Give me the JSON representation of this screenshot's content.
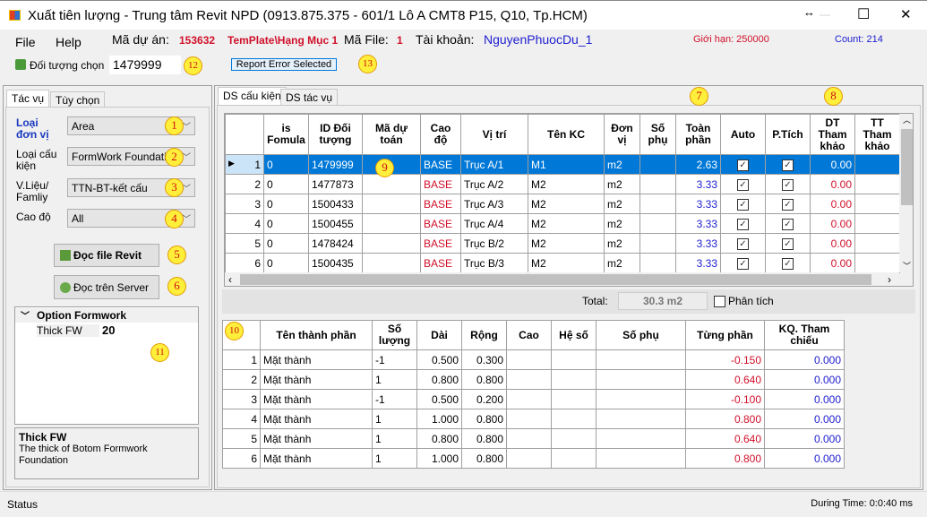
{
  "window": {
    "title": "Xuất tiên lượng - Trung tâm Revit NPD (0913.875.375 - 601/1 Lô A CMT8 P15, Q10, Tp.HCM)",
    "resize_icon": "↔",
    "minimize": "—",
    "maximize": "☐",
    "close": "✕"
  },
  "menu": {
    "file": "File",
    "help": "Help",
    "project_label": "Mã dự án:",
    "project_code": "153632",
    "template": "TemPlate\\Hạng Mục 1",
    "file_label": "Mã File:",
    "file_code": "1",
    "account_label": "Tài khoản:",
    "account": "NguyenPhuocDu_1",
    "limit": "Giới hạn: 250000",
    "count": "Count: 214"
  },
  "toolbar": {
    "selected_label": "Đối tượng chọn",
    "selected_value": "1479999",
    "report_button": "Report Error Selected"
  },
  "left": {
    "tabs": [
      "Tác vụ",
      "Tùy chọn"
    ],
    "fields": [
      {
        "label": "Loại đơn vị",
        "value": "Area"
      },
      {
        "label": "Loại cấu kiện",
        "value": "FormWork Foundation"
      },
      {
        "label": "V.Liệu/ Famliy",
        "value": "TTN-BT-kết cấu"
      },
      {
        "label": "Cao độ",
        "value": "All"
      }
    ],
    "read_revit": "Đọc file Revit",
    "read_server": "Đọc trên Server",
    "property_grid": {
      "category": "Option Formwork",
      "prop_name": "Thick FW",
      "prop_value": "20",
      "desc_title": "Thick FW",
      "desc_text": "The thick of Botom Formwork Foundation"
    }
  },
  "right": {
    "tabs": [
      "DS cấu kiện",
      "DS tác vụ"
    ],
    "grid": {
      "columns": [
        "is Fomula",
        "ID Đối tượng",
        "Mã dự toán",
        "Cao độ",
        "Vị trí",
        "Tên KC",
        "Đơn vị",
        "Số phụ",
        "Toàn phần",
        "Auto",
        "P.Tích",
        "DT Tham khảo",
        "TT Tham khảo"
      ],
      "rows": [
        {
          "n": "1",
          "f": "0",
          "id": "1479999",
          "ma": "",
          "cao": "BASE",
          "vt": "Trục A/1",
          "kc": "M1",
          "dv": "m2",
          "sp": "",
          "tp": "2.63",
          "auto": true,
          "pt": true,
          "dt": "0.00",
          "tt": ""
        },
        {
          "n": "2",
          "f": "0",
          "id": "1477873",
          "ma": "",
          "cao": "BASE",
          "vt": "Trục A/2",
          "kc": "M2",
          "dv": "m2",
          "sp": "",
          "tp": "3.33",
          "auto": true,
          "pt": true,
          "dt": "0.00",
          "tt": ""
        },
        {
          "n": "3",
          "f": "0",
          "id": "1500433",
          "ma": "",
          "cao": "BASE",
          "vt": "Trục A/3",
          "kc": "M2",
          "dv": "m2",
          "sp": "",
          "tp": "3.33",
          "auto": true,
          "pt": true,
          "dt": "0.00",
          "tt": ""
        },
        {
          "n": "4",
          "f": "0",
          "id": "1500455",
          "ma": "",
          "cao": "BASE",
          "vt": "Trục A/4",
          "kc": "M2",
          "dv": "m2",
          "sp": "",
          "tp": "3.33",
          "auto": true,
          "pt": true,
          "dt": "0.00",
          "tt": ""
        },
        {
          "n": "5",
          "f": "0",
          "id": "1478424",
          "ma": "",
          "cao": "BASE",
          "vt": "Trục B/2",
          "kc": "M2",
          "dv": "m2",
          "sp": "",
          "tp": "3.33",
          "auto": true,
          "pt": true,
          "dt": "0.00",
          "tt": ""
        },
        {
          "n": "6",
          "f": "0",
          "id": "1500435",
          "ma": "",
          "cao": "BASE",
          "vt": "Trục B/3",
          "kc": "M2",
          "dv": "m2",
          "sp": "",
          "tp": "3.33",
          "auto": true,
          "pt": true,
          "dt": "0.00",
          "tt": ""
        }
      ]
    },
    "total_label": "Total:",
    "total_value": "30.3 m2",
    "analyze_label": "Phân tích",
    "detail": {
      "columns": [
        "Tên thành phần",
        "Số lượng",
        "Dài",
        "Rộng",
        "Cao",
        "Hệ số",
        "Số phụ",
        "Từng phần",
        "KQ. Tham chiếu"
      ],
      "rows": [
        [
          "1",
          "Mặt thành",
          "-1",
          "0.500",
          "0.300",
          "",
          "",
          "",
          "-0.150",
          "0.000"
        ],
        [
          "2",
          "Mặt thành",
          "1",
          "0.800",
          "0.800",
          "",
          "",
          "",
          "0.640",
          "0.000"
        ],
        [
          "3",
          "Mặt thành",
          "-1",
          "0.500",
          "0.200",
          "",
          "",
          "",
          "-0.100",
          "0.000"
        ],
        [
          "4",
          "Mặt thành",
          "1",
          "1.000",
          "0.800",
          "",
          "",
          "",
          "0.800",
          "0.000"
        ],
        [
          "5",
          "Mặt thành",
          "1",
          "0.800",
          "0.800",
          "",
          "",
          "",
          "0.640",
          "0.000"
        ],
        [
          "6",
          "Mặt thành",
          "1",
          "1.000",
          "0.800",
          "",
          "",
          "",
          "0.800",
          "0.000"
        ]
      ]
    }
  },
  "status": {
    "left": "Status",
    "right": "During Time: 0:0:40 ms"
  },
  "annotations": [
    "1",
    "2",
    "3",
    "4",
    "5",
    "6",
    "7",
    "8",
    "9",
    "10",
    "11",
    "12",
    "13"
  ],
  "colors": {
    "selection": "#0078d7",
    "red_text": "#d0102a",
    "blue_text": "#2020d0",
    "badge": "#ffef3a"
  }
}
